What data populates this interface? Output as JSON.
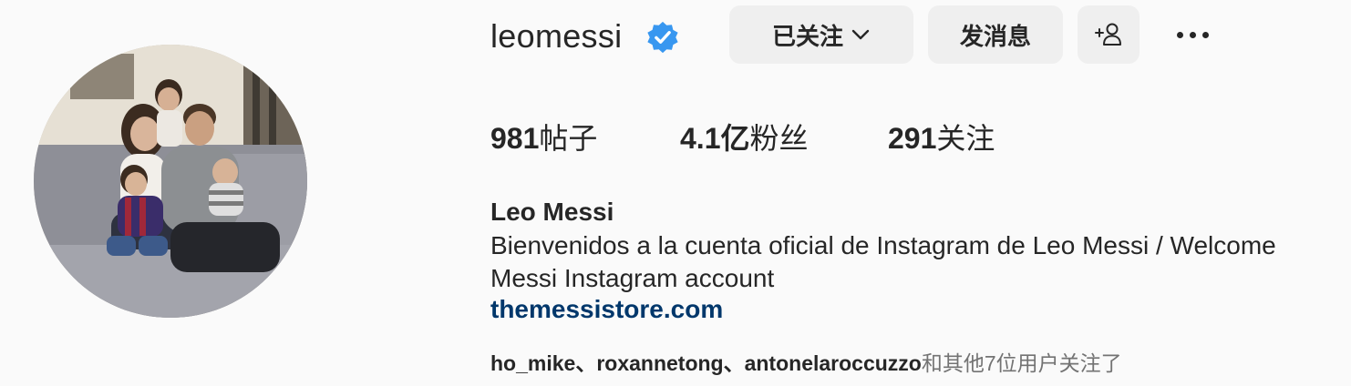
{
  "profile": {
    "username": "leomessi",
    "verified": true,
    "full_name": "Leo Messi",
    "bio_line1": "Bienvenidos a la cuenta oficial de Instagram de Leo Messi / Welcome",
    "bio_line2": "Messi Instagram account",
    "link": "themessistore.com"
  },
  "actions": {
    "following_label": "已关注",
    "message_label": "发消息"
  },
  "stats": {
    "posts_value": "981",
    "posts_label": "帖子",
    "followers_value": "4.1亿",
    "followers_label": "粉丝",
    "following_value": "291",
    "following_label": "关注"
  },
  "followed_by": {
    "names": "ho_mike、roxannetong、antonelaroccuzzo",
    "suffix": "和其他7位用户关注了"
  },
  "icons": {
    "verified": "verified-badge-icon",
    "chevron": "chevron-down-icon",
    "add_user": "add-person-icon",
    "more": "more-dots-icon"
  },
  "colors": {
    "verified_blue": "#3897f0",
    "link_blue": "#00376b",
    "button_bg": "#efefef",
    "page_bg": "#fafafa"
  }
}
